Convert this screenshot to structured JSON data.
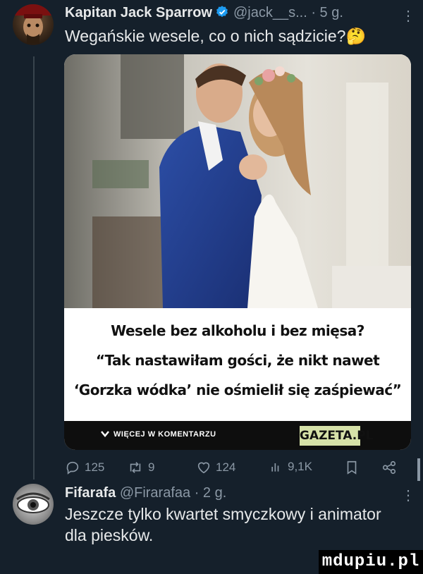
{
  "tweet": {
    "author_name": "Kapitan Jack Sparrow",
    "author_handle": "@jack__s...",
    "time": "· 5 g.",
    "text": "Wegańskie wesele, co o nich sądzicie?🤔",
    "media": {
      "caption_lines": [
        "Wesele bez alkoholu i bez mięsa?",
        "“Tak nastawiłam gości, że nikt nawet",
        "‘Gorzka wódka’ nie ośmielił się zaśpiewać”"
      ],
      "more_comments": "WIĘCEJ W KOMENTARZU",
      "brand": "GAZETA.PL"
    },
    "stats": {
      "replies": "125",
      "retweets": "9",
      "likes": "124",
      "views": "9,1K"
    }
  },
  "reply": {
    "author_name": "Fifarafa",
    "author_handle": "@Firarafaa",
    "time": "· 2 g.",
    "text_lines": [
      "Jeszcze tylko kwartet smyczkowy i animator",
      "dla piesków."
    ]
  },
  "watermark": "mdupiu.pl",
  "icons": [
    "reply-icon",
    "retweet-icon",
    "like-icon",
    "views-icon",
    "bookmark-icon",
    "share-icon",
    "verified-icon",
    "more-icon",
    "chevron-down-icon"
  ],
  "colors": {
    "background": "#15202b",
    "text": "#e7e9ea",
    "muted": "#8b98a5",
    "verified": "#1d9bf0"
  }
}
